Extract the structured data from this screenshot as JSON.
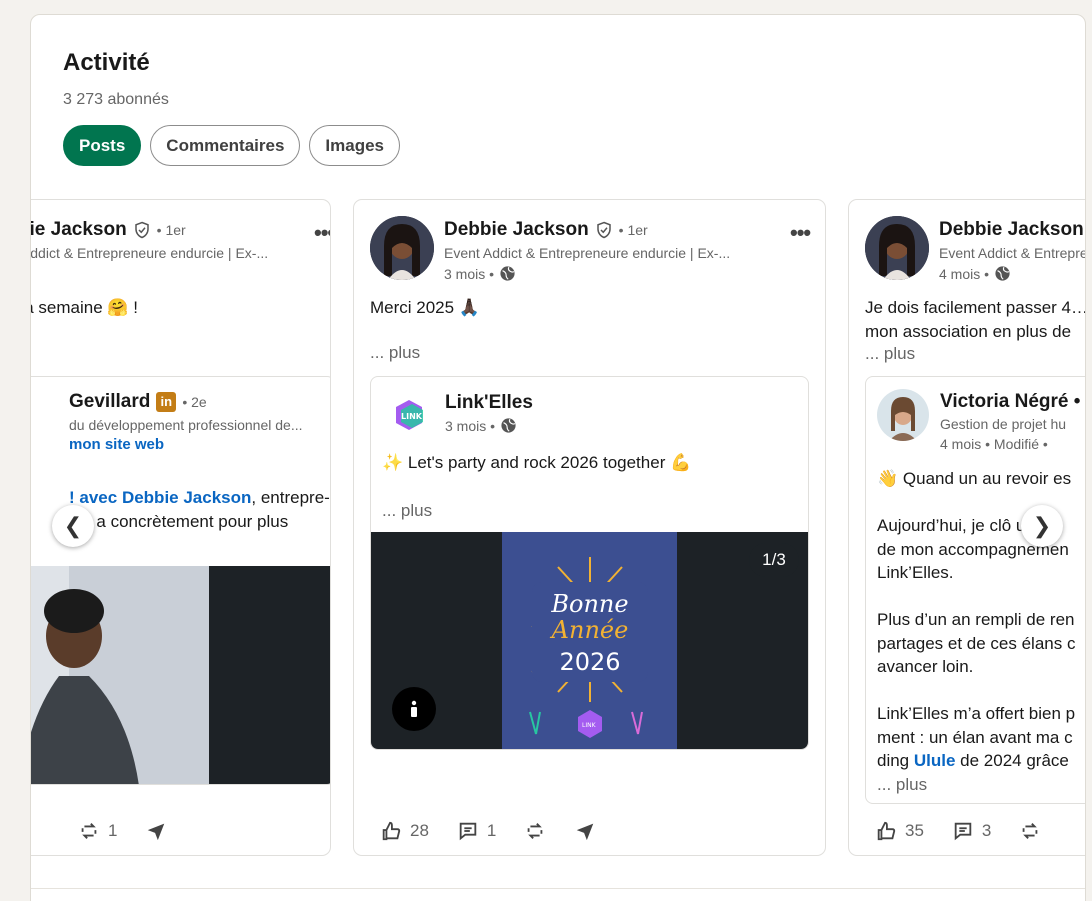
{
  "section": {
    "title": "Activité",
    "followers": "3 273 abonnés",
    "pills": [
      "Posts",
      "Commentaires",
      "Images"
    ]
  },
  "cards": [
    {
      "author": "Debbie Jackson",
      "degree": "• 1er",
      "headline": "Event Addict & Entrepreneure endurcie | Ex-...",
      "text": "Bien démarrer la semaine 🤗 !",
      "inner": {
        "author": "Gevillard",
        "degree": "• 2e",
        "headline": "du développement professionnel de...",
        "link": "mon site web",
        "line1_pre": " ! avec ",
        "line1_link": "Debbie Jackson",
        "line1_post": ", entrepre-",
        "line2": "qui a concrètement pour plus"
      },
      "actions": {
        "reposts": "1"
      }
    },
    {
      "author": "Debbie Jackson",
      "degree": "• 1er",
      "headline": "Event Addict & Entrepreneure endurcie | Ex-...",
      "time": "3 mois •",
      "text": "Merci 2025 🙏🏿",
      "more": "... plus",
      "inner": {
        "author": "Link'Elles",
        "time": "3 mois •",
        "text": "✨ Let's party and rock 2026 together 💪",
        "more": "... plus",
        "counter": "1/3",
        "image_line1": "Bonne",
        "image_line2": "Année",
        "image_line3": "2026",
        "image_logo": "LINK"
      },
      "actions": {
        "likes": "28",
        "comments": "1"
      }
    },
    {
      "author": "Debbie Jackson",
      "headline": "Event Addict & Entrepreneure endurcie",
      "time": "4 mois •",
      "text1": "Je dois facilement passer 4…",
      "text2": "mon association en plus de",
      "more": "... plus",
      "inner": {
        "author": "Victoria Négré •",
        "headline": "Gestion de projet hu",
        "time": "4 mois • Modifié •",
        "l1": "👋 Quand un au revoir es",
        "l2": "Aujourd’hui, je clô un",
        "l3": "de mon accompagnemen",
        "l4": "Link’Elles.",
        "l5": "Plus d’un an rempli de ren",
        "l6": "partages et de ces élans c",
        "l7": "avancer loin.",
        "l8": "Link’Elles m’a offert bien p",
        "l9": "ment : un élan avant ma c",
        "l10_pre": "ding ",
        "l10_link": "Ulule",
        "l10_post": " de 2024 grâce",
        "more": "... plus"
      },
      "actions": {
        "likes": "35",
        "comments": "3"
      }
    }
  ],
  "nav": {
    "prev": "❮",
    "next": "❯"
  },
  "more_icon": "•••",
  "colors": {
    "accent_green": "#01754f",
    "link_blue": "#0a66c2",
    "dark_bg": "#1d2226",
    "card_image_blue": "#3c4f91"
  }
}
